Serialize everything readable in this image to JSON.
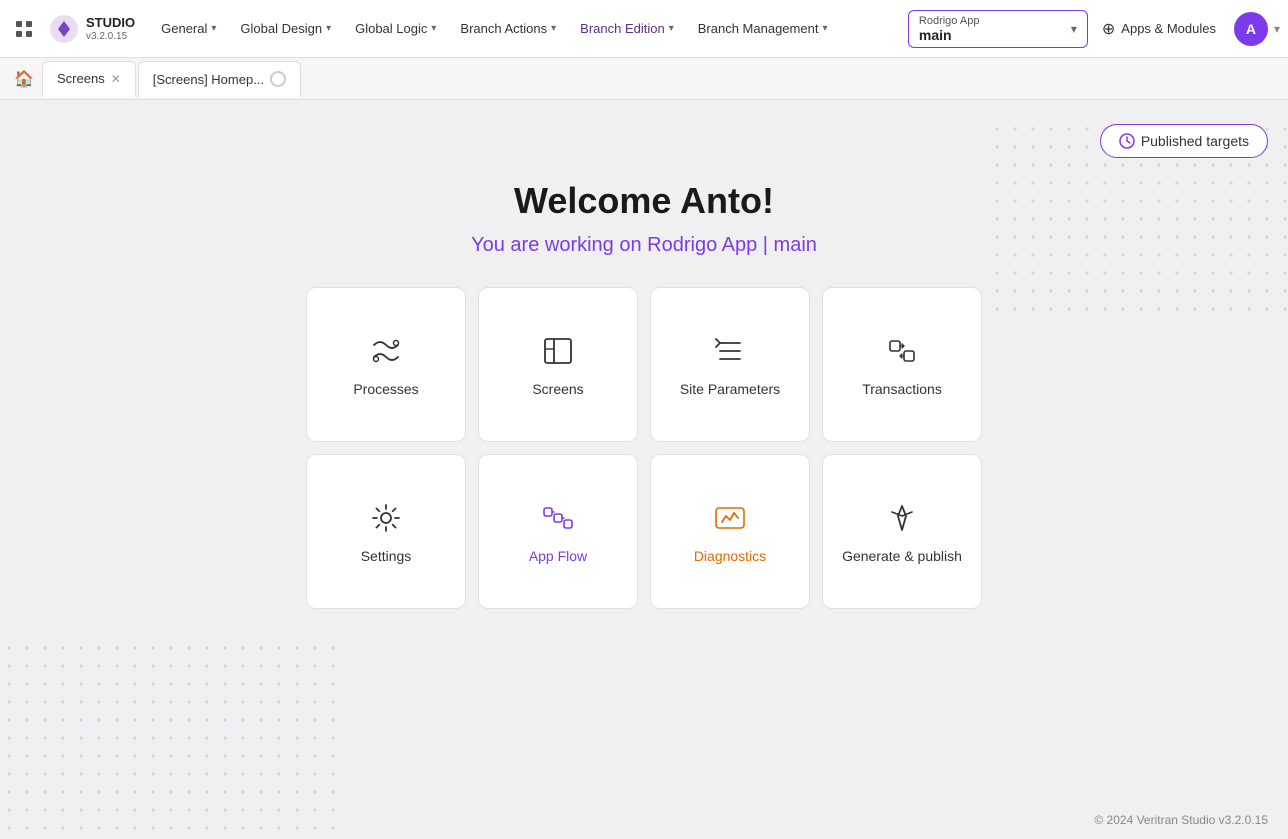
{
  "app": {
    "name": "STUDIO",
    "version": "v3.2.0.15"
  },
  "topnav": {
    "items": [
      {
        "id": "general",
        "label": "General",
        "hasDropdown": true
      },
      {
        "id": "global-design",
        "label": "Global Design",
        "hasDropdown": true
      },
      {
        "id": "global-logic",
        "label": "Global Logic",
        "hasDropdown": true
      },
      {
        "id": "branch-actions",
        "label": "Branch Actions",
        "hasDropdown": true
      },
      {
        "id": "branch-edition",
        "label": "Branch Edition",
        "hasDropdown": true
      },
      {
        "id": "branch-management",
        "label": "Branch Management",
        "hasDropdown": true
      }
    ],
    "branch": {
      "app_name": "Rodrigo App",
      "branch": "main"
    },
    "apps_modules": "Apps & Modules",
    "user_initial": "A"
  },
  "tabbar": {
    "tabs": [
      {
        "id": "screens",
        "label": "Screens",
        "closeable": true,
        "loading": false
      },
      {
        "id": "screens-home",
        "label": "[Screens] Homep...",
        "closeable": false,
        "loading": true
      }
    ]
  },
  "main": {
    "published_targets": "Published targets",
    "welcome_title": "Welcome Anto!",
    "welcome_subtitle": "You are working on Rodrigo App | main",
    "cards": [
      {
        "id": "processes",
        "label": "Processes",
        "icon": "processes",
        "highlight": false
      },
      {
        "id": "screens",
        "label": "Screens",
        "icon": "screens",
        "highlight": false
      },
      {
        "id": "site-parameters",
        "label": "Site Parameters",
        "icon": "site-parameters",
        "highlight": false
      },
      {
        "id": "transactions",
        "label": "Transactions",
        "icon": "transactions",
        "highlight": false
      },
      {
        "id": "settings",
        "label": "Settings",
        "icon": "settings",
        "highlight": false
      },
      {
        "id": "app-flow",
        "label": "App Flow",
        "icon": "app-flow",
        "highlight": true
      },
      {
        "id": "diagnostics",
        "label": "Diagnostics",
        "icon": "diagnostics",
        "highlight": true,
        "highlight_color": "orange"
      },
      {
        "id": "generate-publish",
        "label": "Generate & publish",
        "icon": "generate-publish",
        "highlight": false
      }
    ]
  },
  "footer": {
    "text": "© 2024 Veritran Studio v3.2.0.15"
  }
}
